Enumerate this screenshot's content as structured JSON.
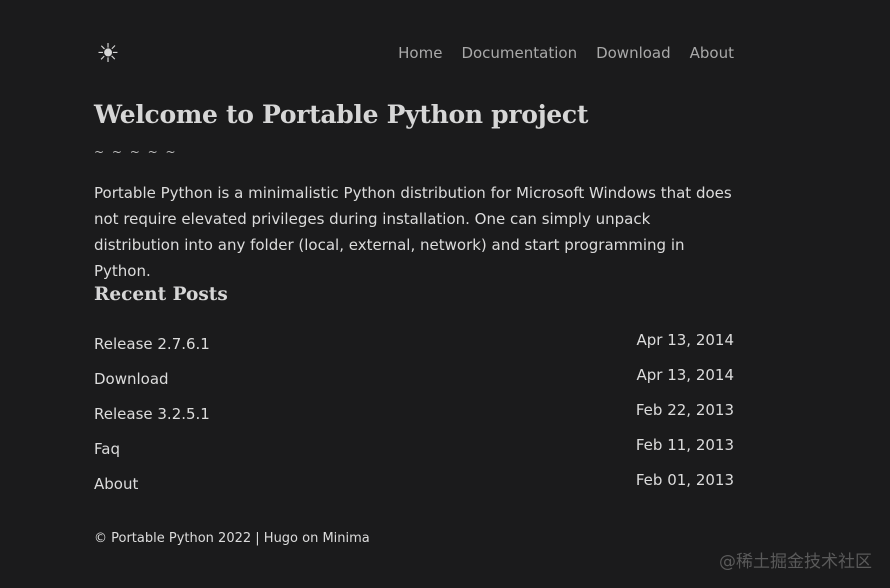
{
  "header": {
    "logo_icon": "sun-icon",
    "nav": [
      {
        "label": "Home"
      },
      {
        "label": "Documentation"
      },
      {
        "label": "Download"
      },
      {
        "label": "About"
      }
    ]
  },
  "main": {
    "title": "Welcome to Portable Python project",
    "separator": "~ ~ ~ ~ ~",
    "intro": "Portable Python is a minimalistic Python distribution for Microsoft Windows that does not require elevated privileges during installation. One can simply unpack distribution into any folder (local, external, network) and start programming in Python.",
    "recent_title": "Recent Posts",
    "posts": [
      {
        "title": "Release 2.7.6.1",
        "date": "Apr 13, 2014"
      },
      {
        "title": "Download",
        "date": "Apr 13, 2014"
      },
      {
        "title": "Release 3.2.5.1",
        "date": "Feb 22, 2013"
      },
      {
        "title": "Faq",
        "date": "Feb 11, 2013"
      },
      {
        "title": "About",
        "date": "Feb 01, 2013"
      }
    ]
  },
  "footer": {
    "text": "© Portable Python 2022 | Hugo on Minima"
  },
  "watermark": "@稀土掘金技术社区"
}
